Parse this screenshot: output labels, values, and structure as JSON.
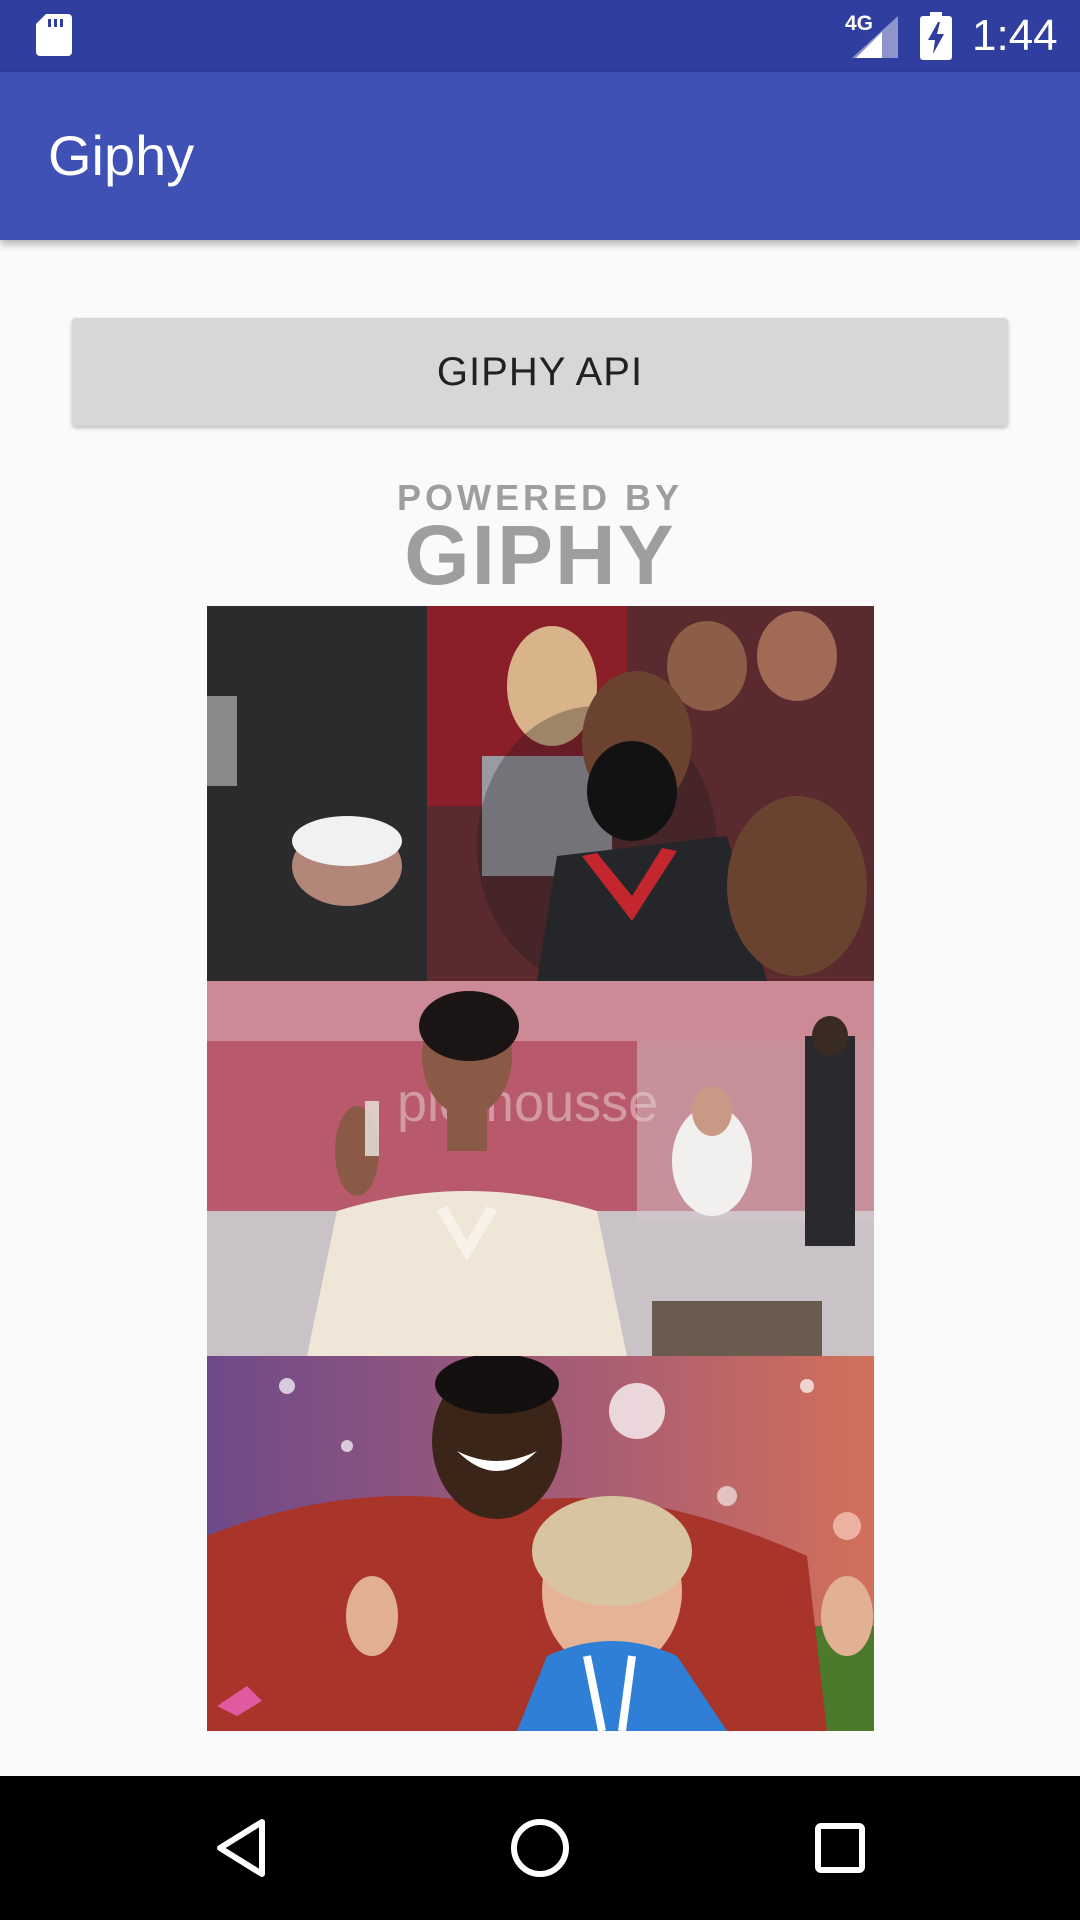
{
  "status_bar": {
    "network_label": "4G",
    "time": "1:44",
    "icons": [
      "sd-card-icon",
      "signal-icon",
      "battery-charging-icon"
    ]
  },
  "app_bar": {
    "title": "Giphy"
  },
  "main": {
    "api_button_label": "GIPHY API",
    "attribution": {
      "powered_by": "POWERED BY",
      "brand": "GIPHY"
    },
    "gifs": [
      {
        "name": "gif-basketball"
      },
      {
        "name": "gif-champagne-toast"
      },
      {
        "name": "gif-celebration"
      }
    ]
  },
  "nav_bar": {
    "icons": [
      "back-icon",
      "home-icon",
      "recents-icon"
    ]
  },
  "colors": {
    "status_bar": "#303f9f",
    "app_bar": "#3f51b5",
    "background": "#fafafa",
    "button": "#d6d7d7",
    "logo_gray": "#9e9e9e"
  }
}
